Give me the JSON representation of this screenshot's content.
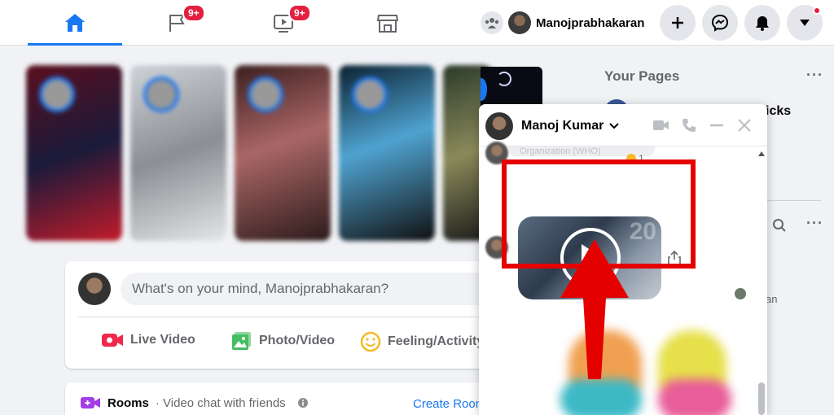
{
  "topbar": {
    "tabs": [
      {
        "name": "home",
        "badge": ""
      },
      {
        "name": "pages",
        "badge": "9+"
      },
      {
        "name": "watch",
        "badge": "9+"
      },
      {
        "name": "marketplace",
        "badge": ""
      }
    ],
    "profile_name": "Manojprabhakaran",
    "accent_color": "#1877f2"
  },
  "composer": {
    "placeholder": "What's on your mind, Manojprabhakaran?",
    "actions": {
      "live_video": "Live Video",
      "photo_video": "Photo/Video",
      "feeling": "Feeling/Activity"
    }
  },
  "rooms": {
    "title": "Rooms",
    "subtitle": "Video chat with friends",
    "create_label": "Create Room"
  },
  "right_column": {
    "your_pages_title": "Your Pages",
    "page_name_fragment": "icks",
    "partial_text": "an"
  },
  "chat": {
    "contact_name": "Manoj Kumar",
    "faded_message_fragment": "Organization (WHO)",
    "reaction_count": "1",
    "video_overlay_text": "20"
  }
}
